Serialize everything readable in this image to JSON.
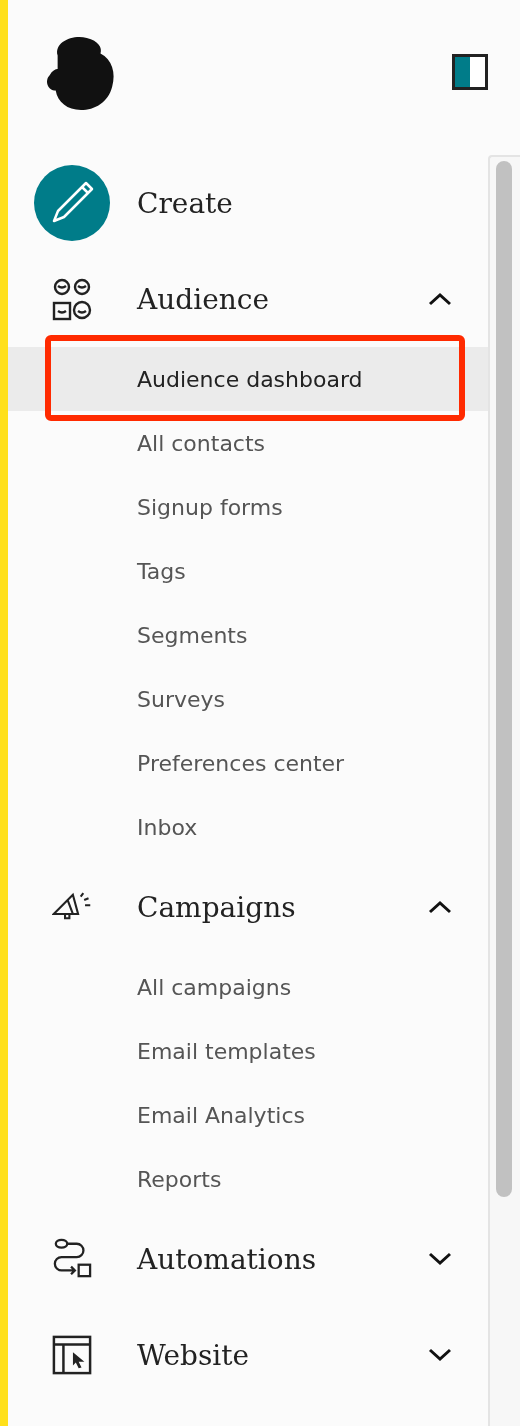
{
  "sections": [
    {
      "kind": "create",
      "label": "Create"
    },
    {
      "kind": "group",
      "label": "Audience",
      "expanded": true,
      "items": [
        {
          "label": "Audience dashboard",
          "selected": true
        },
        {
          "label": "All contacts",
          "selected": false
        },
        {
          "label": "Signup forms",
          "selected": false
        },
        {
          "label": "Tags",
          "selected": false
        },
        {
          "label": "Segments",
          "selected": false
        },
        {
          "label": "Surveys",
          "selected": false
        },
        {
          "label": "Preferences center",
          "selected": false
        },
        {
          "label": "Inbox",
          "selected": false
        }
      ]
    },
    {
      "kind": "group",
      "label": "Campaigns",
      "expanded": true,
      "items": [
        {
          "label": "All campaigns",
          "selected": false
        },
        {
          "label": "Email templates",
          "selected": false
        },
        {
          "label": "Email Analytics",
          "selected": false
        },
        {
          "label": "Reports",
          "selected": false
        }
      ]
    },
    {
      "kind": "group",
      "label": "Automations",
      "expanded": false
    },
    {
      "kind": "group",
      "label": "Website",
      "expanded": false
    }
  ]
}
